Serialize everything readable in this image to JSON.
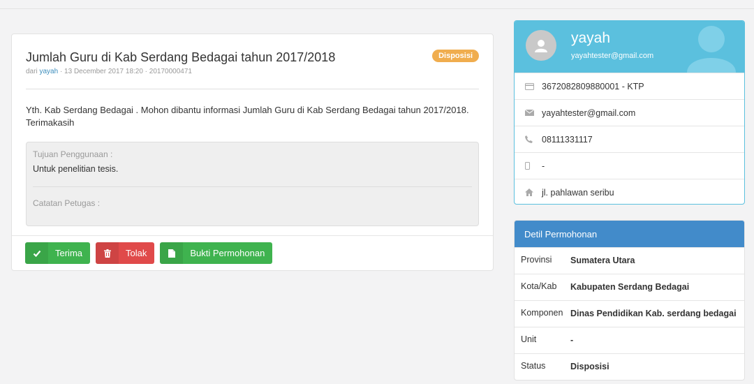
{
  "request": {
    "title": "Jumlah Guru di Kab Serdang Bedagai tahun 2017/2018",
    "badge": "Disposisi",
    "meta_prefix": "dari",
    "meta_user": "yayah",
    "meta_suffix": "· 13 December 2017 18:20 · 20170000471",
    "message": "Yth. Kab Serdang Bedagai . Mohon dibantu informasi Jumlah Guru di Kab Serdang Bedagai tahun 2017/2018. Terimakasih",
    "purpose_label": "Tujuan Penggunaan :",
    "purpose_value": "Untuk penelitian tesis.",
    "notes_label": "Catatan Petugas :"
  },
  "actions": {
    "accept_label": "Terima",
    "reject_label": "Tolak",
    "proof_label": "Bukti Permohonan"
  },
  "profile": {
    "name": "yayah",
    "email": "yayahtester@gmail.com",
    "id_number": "3672082809880001 - KTP",
    "contact_email": "yayahtester@gmail.com",
    "phone": "08111331117",
    "mobile": "-",
    "address": "jl. pahlawan seribu"
  },
  "detail": {
    "header": "Detil Permohonan",
    "rows": [
      {
        "key": "Provinsi",
        "value": "Sumatera Utara"
      },
      {
        "key": "Kota/Kab",
        "value": "Kabupaten Serdang Bedagai"
      },
      {
        "key": "Komponen",
        "value": "Dinas Pendidikan Kab. serdang bedagai"
      },
      {
        "key": "Unit",
        "value": "-"
      },
      {
        "key": "Status",
        "value": "Disposisi"
      }
    ]
  },
  "colors": {
    "accept": "#3fb34f",
    "reject": "#e04a4a",
    "badge": "#f0ad4e",
    "profile_header": "#5bc0de",
    "detail_header": "#428bca"
  },
  "icons": [
    "check-icon",
    "trash-icon",
    "document-icon",
    "user-avatar-icon",
    "id-card-icon",
    "envelope-icon",
    "phone-icon",
    "mobile-icon",
    "home-icon"
  ]
}
